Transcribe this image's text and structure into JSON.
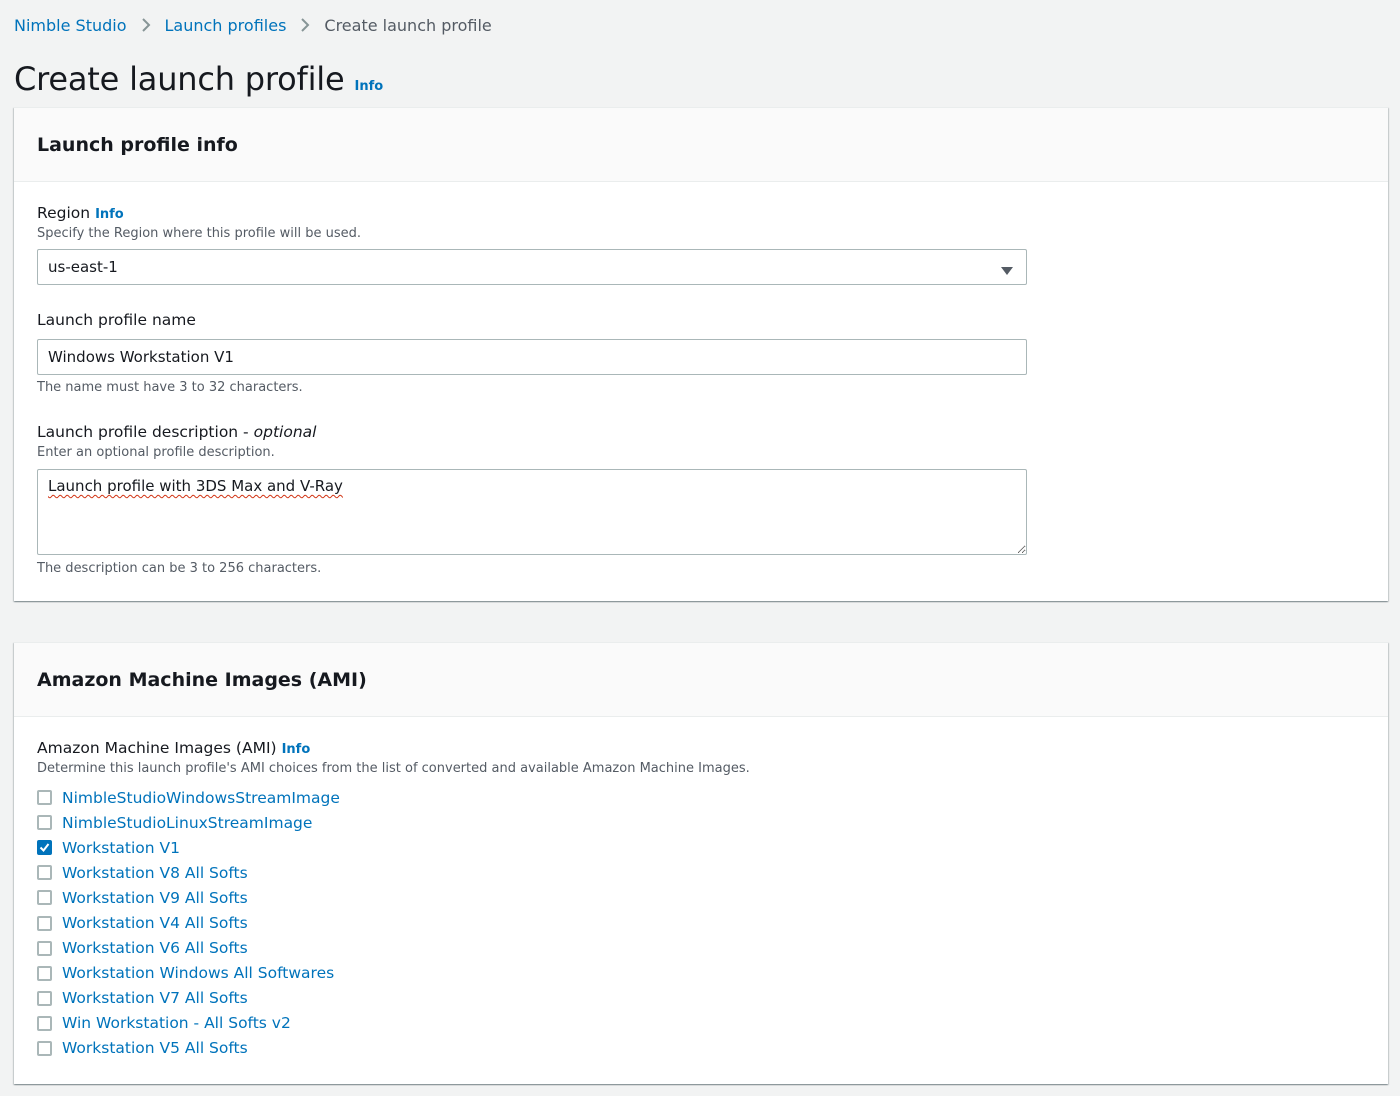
{
  "breadcrumb": {
    "items": [
      "Nimble Studio",
      "Launch profiles"
    ],
    "current": "Create launch profile"
  },
  "page": {
    "title": "Create launch profile",
    "info": "Info"
  },
  "launch_profile_info": {
    "heading": "Launch profile info",
    "region": {
      "label": "Region",
      "info": "Info",
      "description": "Specify the Region where this profile will be used.",
      "value": "us-east-1"
    },
    "name": {
      "label": "Launch profile name",
      "value": "Windows Workstation V1",
      "constraint": "The name must have 3 to 32 characters."
    },
    "description": {
      "label": "Launch profile description -",
      "optional": "optional",
      "hint": "Enter an optional profile description.",
      "value": "Launch profile with 3DS Max and V-Ray",
      "constraint": "The description can be 3 to 256 characters."
    }
  },
  "ami_section": {
    "heading": "Amazon Machine Images (AMI)",
    "label": "Amazon Machine Images (AMI)",
    "info": "Info",
    "description": "Determine this launch profile's AMI choices from the list of converted and available Amazon Machine Images.",
    "items": [
      {
        "label": "NimbleStudioWindowsStreamImage",
        "checked": false
      },
      {
        "label": "NimbleStudioLinuxStreamImage",
        "checked": false
      },
      {
        "label": "Workstation V1",
        "checked": true
      },
      {
        "label": "Workstation V8 All Softs",
        "checked": false
      },
      {
        "label": "Workstation V9 All Softs",
        "checked": false
      },
      {
        "label": "Workstation V4 All Softs",
        "checked": false
      },
      {
        "label": "Workstation V6 All Softs",
        "checked": false
      },
      {
        "label": "Workstation Windows All Softwares",
        "checked": false
      },
      {
        "label": "Workstation V7 All Softs",
        "checked": false
      },
      {
        "label": "Win Workstation - All Softs v2",
        "checked": false
      },
      {
        "label": "Workstation V5 All Softs",
        "checked": false
      }
    ]
  },
  "colors": {
    "link": "#0073bb",
    "text": "#16191f",
    "secondary_text": "#545b64",
    "background": "#f2f3f3",
    "border": "#aab7b8"
  }
}
